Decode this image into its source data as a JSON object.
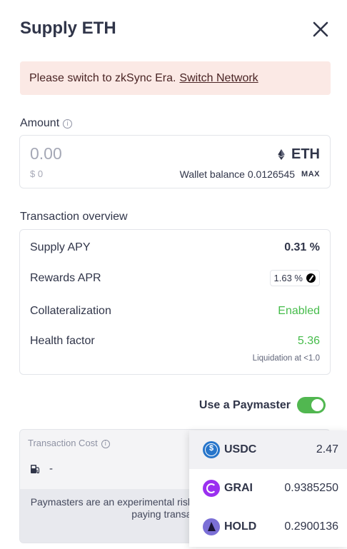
{
  "modal": {
    "title": "Supply ETH"
  },
  "alert": {
    "message": "Please switch to zkSync Era.",
    "link_label": "Switch Network"
  },
  "amount": {
    "label": "Amount",
    "placeholder": "0.00",
    "usd_value": "$ 0",
    "token_symbol": "ETH",
    "token_icon": "ethereum-icon",
    "wallet_balance_label": "Wallet balance",
    "wallet_balance_value": "0.0126545",
    "max_label": "MAX"
  },
  "overview": {
    "label": "Transaction overview",
    "rows": {
      "supply_apy": {
        "label": "Supply APY",
        "value": "0.31 %"
      },
      "rewards_apr": {
        "label": "Rewards APR",
        "value": "1.63 %",
        "icon": "zksync-reward-icon"
      },
      "collateralization": {
        "label": "Collateralization",
        "value": "Enabled"
      },
      "health_factor": {
        "label": "Health factor",
        "value": "5.36",
        "note": "Liquidation at <1.0"
      }
    },
    "positive_color": "#46bc4b"
  },
  "paymaster": {
    "label": "Use a Paymaster",
    "enabled": true,
    "toggle_color": "#51b750"
  },
  "transaction_cost": {
    "label": "Transaction Cost",
    "gas_icon": "gas-pump-icon",
    "value": "-",
    "note": "Paymasters are an experimental risk. Paymaster integration is po paying transaction f"
  },
  "paymaster_tokens": [
    {
      "symbol": "USDC",
      "amount": "2.47",
      "icon": "usdc-icon",
      "selected": true
    },
    {
      "symbol": "GRAI",
      "amount": "0.9385250",
      "icon": "grai-icon",
      "selected": false
    },
    {
      "symbol": "HOLD",
      "amount": "0.2900136",
      "icon": "hold-icon",
      "selected": false
    }
  ]
}
